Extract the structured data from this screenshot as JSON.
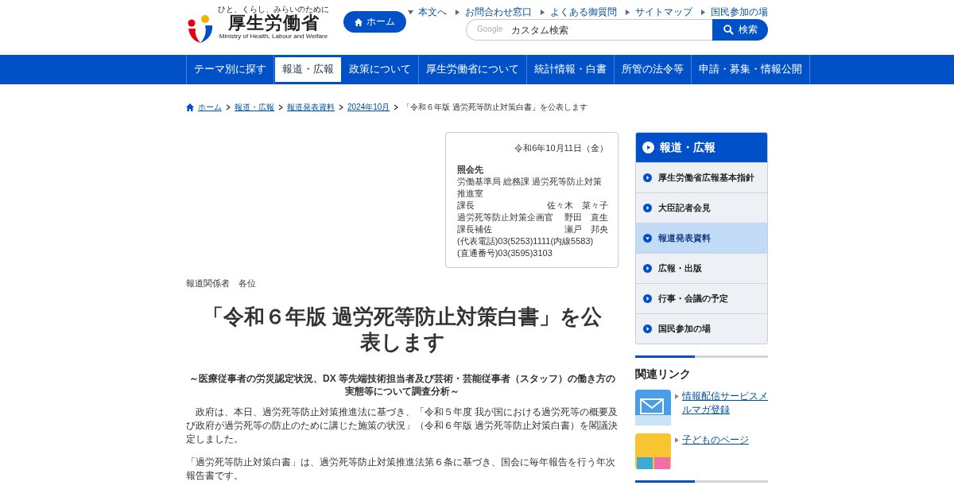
{
  "header": {
    "logo": {
      "tagline": "ひと、くらし、みらいのために",
      "name": "厚生労働省",
      "english": "Ministry of Health, Labour and Welfare"
    },
    "home_button": "ホーム",
    "utility_links": [
      "本文へ",
      "お問合わせ窓口",
      "よくある御質問",
      "サイトマップ",
      "国民参加の場"
    ],
    "search": {
      "brand": "Google",
      "placeholder": "カスタム検索",
      "button": "検索"
    }
  },
  "nav": [
    {
      "label": "テーマ別に探す",
      "selected": false
    },
    {
      "label": "報道・広報",
      "selected": true
    },
    {
      "label": "政策について",
      "selected": false
    },
    {
      "label": "厚生労働省について",
      "selected": false
    },
    {
      "label": "統計情報・白書",
      "selected": false
    },
    {
      "label": "所管の法令等",
      "selected": false
    },
    {
      "label": "申請・募集・情報公開",
      "selected": false
    }
  ],
  "breadcrumb": {
    "links": [
      "ホーム",
      "報道・広報",
      "報道発表資料",
      "2024年10月"
    ],
    "current": "「令和６年版 過労死等防止対策白書」を公表します"
  },
  "contact": {
    "date": "令和6年10月11日（金）",
    "heading": "照会先",
    "department": "労働基準局 総務課 過労死等防止対策推進室",
    "staff": [
      {
        "title": "課長",
        "name": "佐々木　菜々子"
      },
      {
        "title": "過労死等防止対策企画官",
        "name": "野田　直生"
      },
      {
        "title": "課長補佐",
        "name": "瀬戸　邦央"
      }
    ],
    "phones": [
      "(代表電話)03(5253)1111(内線5583)",
      "(直通番号)03(3595)3103"
    ]
  },
  "recipients": "報道関係者　各位",
  "title": "「令和６年版 過労死等防止対策白書」を公表します",
  "subtitle": "～医療従事者の労災認定状況、DX 等先端技術担当者及び芸術・芸能従事者（スタッフ）の働き方の実態等について調査分析～",
  "paragraphs": [
    "　政府は、本日、過労死等防止対策推進法に基づき、「令和５年度 我が国における過労死等の概要及び政府が過労死等の防止のために講じた施策の状況」（令和６年版 過労死等防止対策白書）を閣議決定しました。",
    "「過労死等防止対策白書」は、過労死等防止対策推進法第６条に基づき、国会に毎年報告を行う年次報告書です。"
  ],
  "sidebar": {
    "heading": "報道・広報",
    "items": [
      {
        "label": "厚生労働省広報基本指針",
        "selected": false
      },
      {
        "label": "大臣記者会見",
        "selected": false
      },
      {
        "label": "報道発表資料",
        "selected": true
      },
      {
        "label": "広報・出版",
        "selected": false
      },
      {
        "label": "行事・会議の予定",
        "selected": false
      },
      {
        "label": "国民参加の場",
        "selected": false
      }
    ]
  },
  "related": {
    "heading": "関連リンク",
    "links": [
      {
        "label": "情報配信サービスメルマガ登録",
        "kind": "mail"
      },
      {
        "label": "子どものページ",
        "kind": "kids"
      }
    ]
  }
}
